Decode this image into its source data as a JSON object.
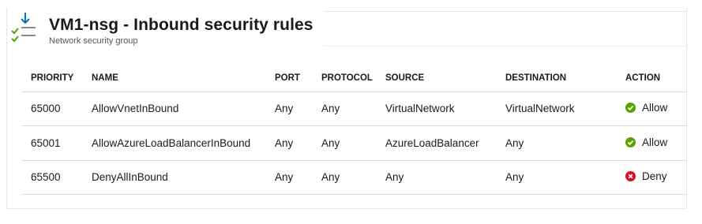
{
  "header": {
    "title": "VM1-nsg - Inbound security rules",
    "subtitle": "Network security group",
    "icon": "inbound-rules-icon"
  },
  "table": {
    "columns": [
      "PRIORITY",
      "NAME",
      "PORT",
      "PROTOCOL",
      "SOURCE",
      "DESTINATION",
      "ACTION"
    ],
    "rows": [
      {
        "priority": "65000",
        "name": "AllowVnetInBound",
        "port": "Any",
        "protocol": "Any",
        "source": "VirtualNetwork",
        "destination": "VirtualNetwork",
        "action": "Allow",
        "action_icon": "check-circle-icon"
      },
      {
        "priority": "65001",
        "name": "AllowAzureLoadBalancerInBound",
        "port": "Any",
        "protocol": "Any",
        "source": "AzureLoadBalancer",
        "destination": "Any",
        "action": "Allow",
        "action_icon": "check-circle-icon"
      },
      {
        "priority": "65500",
        "name": "DenyAllInBound",
        "port": "Any",
        "protocol": "Any",
        "source": "Any",
        "destination": "Any",
        "action": "Deny",
        "action_icon": "error-circle-icon"
      }
    ]
  },
  "colors": {
    "allow": "#57a300",
    "deny": "#e00b1c",
    "accent": "#0072c6",
    "border": "#dcdcdc"
  }
}
